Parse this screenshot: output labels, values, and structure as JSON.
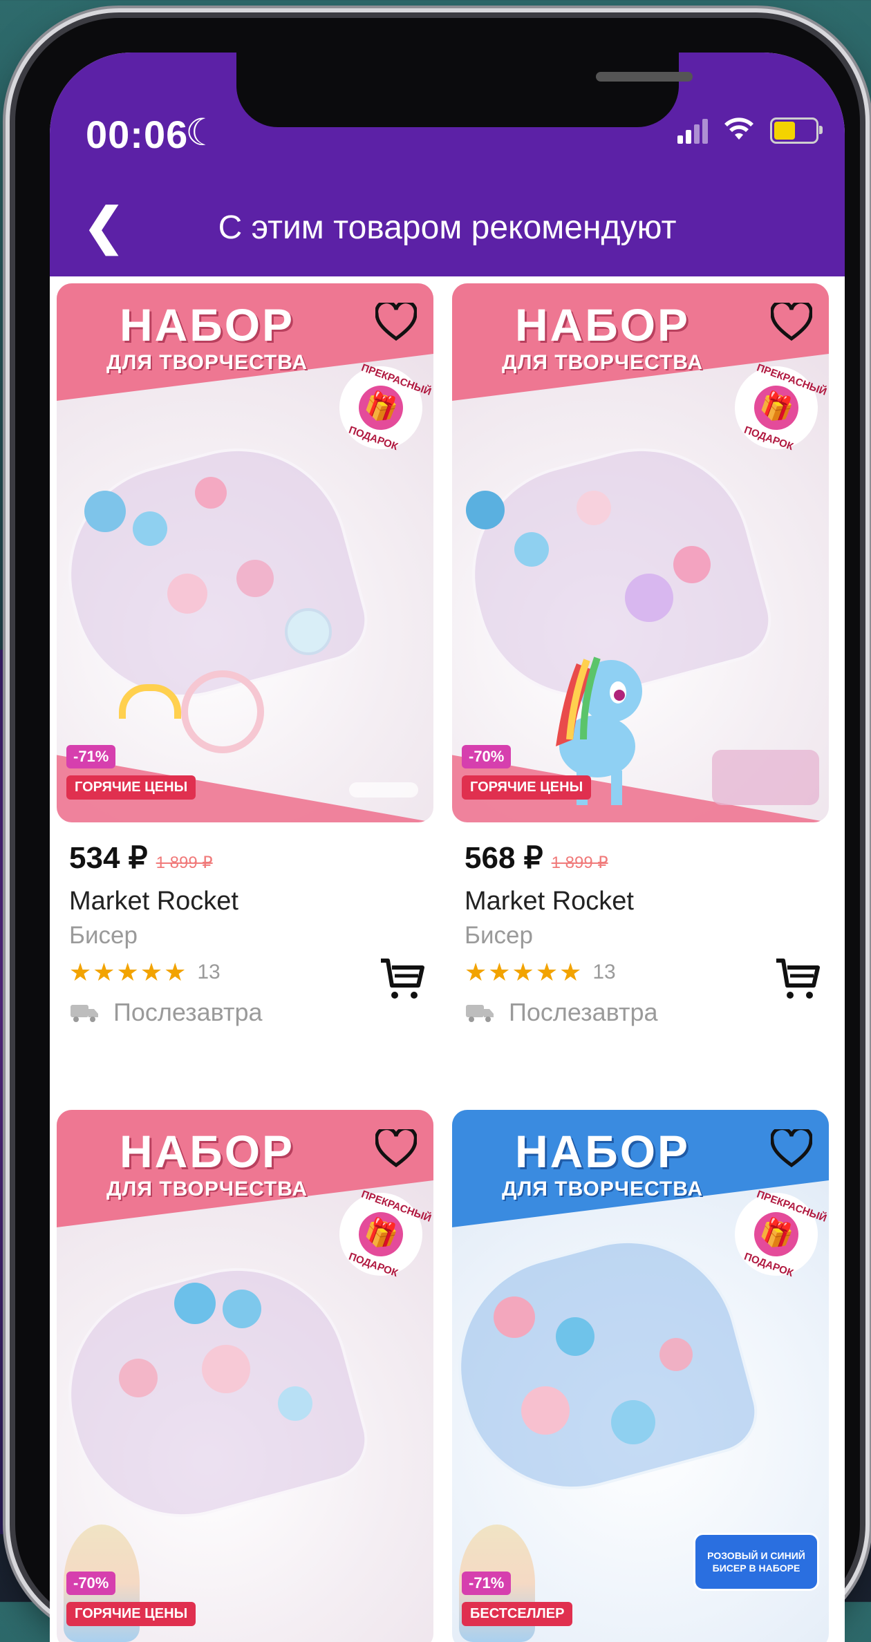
{
  "status_bar": {
    "time": "00:06",
    "moon": "☾"
  },
  "header": {
    "back_glyph": "❮",
    "title": "С этим товаром рекомендуют"
  },
  "colors": {
    "header": "#5c21a6",
    "pink_banner": "#ee7792",
    "blue_banner": "#3a8be0",
    "star": "#f2a300",
    "old_price": "#f07a7a"
  },
  "products": [
    {
      "banner_title": "НАБОР",
      "banner_subtitle": "ДЛЯ ТВОРЧЕСТВА",
      "gift_text_top": "ПРЕКРАСНЫЙ",
      "gift_text_bottom": "ПОДАРОК",
      "discount": "-71%",
      "badge": "ГОРЯЧИЕ ЦЕНЫ",
      "price": "534 ₽",
      "old_price": "1 899 ₽",
      "brand": "Market Rocket",
      "category": "Бисер",
      "stars": "★★★★★",
      "reviews": "13",
      "delivery": "Послезавтра"
    },
    {
      "banner_title": "НАБОР",
      "banner_subtitle": "ДЛЯ ТВОРЧЕСТВА",
      "gift_text_top": "ПРЕКРАСНЫЙ",
      "gift_text_bottom": "ПОДАРОК",
      "discount": "-70%",
      "badge": "ГОРЯЧИЕ ЦЕНЫ",
      "price": "568 ₽",
      "old_price": "1 899 ₽",
      "brand": "Market Rocket",
      "category": "Бисер",
      "stars": "★★★★★",
      "reviews": "13",
      "delivery": "Послезавтра"
    },
    {
      "banner_title": "НАБОР",
      "banner_subtitle": "ДЛЯ ТВОРЧЕСТВА",
      "gift_text_top": "ПРЕКРАСНЫЙ",
      "gift_text_bottom": "ПОДАРОК",
      "discount": "-70%",
      "badge": "ГОРЯЧИЕ ЦЕНЫ"
    },
    {
      "banner_title": "НАБОР",
      "banner_subtitle": "ДЛЯ ТВОРЧЕСТВА",
      "gift_text_top": "ПРЕКРАСНЫЙ",
      "gift_text_bottom": "ПОДАРОК",
      "discount": "-71%",
      "badge": "БЕСТСЕЛЛЕР",
      "promo": "РОЗОВЫЙ И СИНИЙ БИСЕР В НАБОРЕ"
    }
  ]
}
